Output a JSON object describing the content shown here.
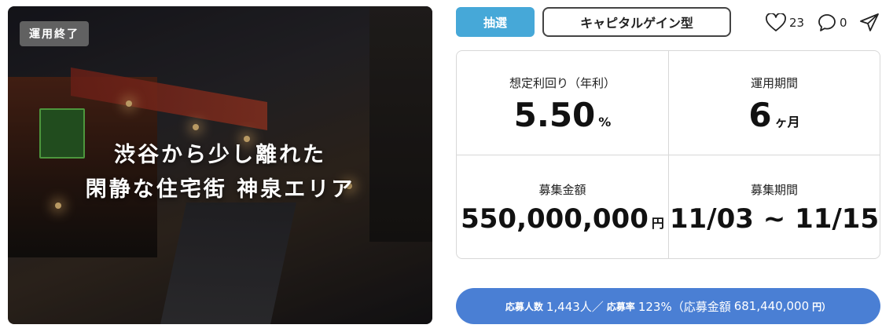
{
  "hero": {
    "status_badge": "運用終了",
    "copy_line1": "渋谷から少し離れた",
    "copy_line2": "閑静な住宅街 神泉エリア"
  },
  "tags": {
    "lottery": "抽選",
    "type": "キャピタルゲイン型"
  },
  "social": {
    "like_count": "23",
    "comment_count": "0",
    "like_icon": "heart-icon",
    "comment_icon": "speech-bubble-icon",
    "share_icon": "paper-plane-icon"
  },
  "metrics": {
    "yield_label": "想定利回り（年利）",
    "yield_value": "5.50",
    "yield_unit": "%",
    "period_label": "運用期間",
    "period_value": "6",
    "period_unit": "ヶ月",
    "amount_label": "募集金額",
    "amount_value": "550,000,000",
    "amount_unit": "円",
    "recruit_label": "募集期間",
    "recruit_value": "11/03 ~ 11/15"
  },
  "apply": {
    "applicants_label": "応募人数",
    "applicants_value": "1,443人／",
    "rate_label": "応募率",
    "rate_value": "123%（応募金額",
    "amount_value": "681,440,000",
    "amount_unit": "円）"
  },
  "colors": {
    "lottery_tag": "#46a8d8",
    "apply_bar": "#4a7fd4"
  }
}
